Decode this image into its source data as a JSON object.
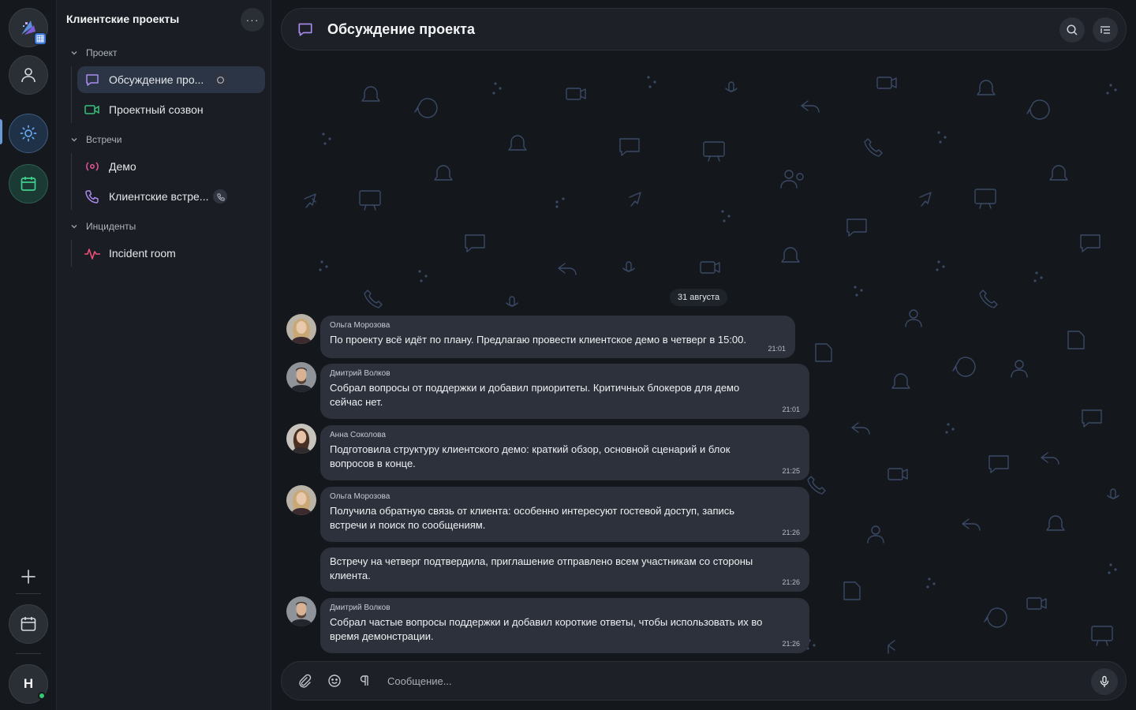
{
  "rail": {
    "user_initial": "Н"
  },
  "sidebar": {
    "title": "Клиентские проекты",
    "more_label": "···",
    "groups": [
      {
        "label": "Проект"
      },
      {
        "label": "Встречи"
      },
      {
        "label": "Инциденты"
      }
    ],
    "items": [
      {
        "label": "Обсуждение про...",
        "icon": "chat-icon"
      },
      {
        "label": "Проектный созвон",
        "icon": "video-icon"
      },
      {
        "label": "Демо",
        "icon": "broadcast-icon"
      },
      {
        "label": "Клиентские встре...",
        "icon": "phone-icon"
      },
      {
        "label": "Incident room",
        "icon": "pulse-icon"
      }
    ]
  },
  "header": {
    "title": "Обсуждение проекта"
  },
  "chat": {
    "date_divider": "31 августа",
    "messages": [
      {
        "author": "Ольга Морозова",
        "text": "По проекту всё идёт по плану. Предлагаю провести клиентское демо в четверг в 15:00.",
        "time": "21:01"
      },
      {
        "author": "Дмитрий Волков",
        "text": "Собрал вопросы от поддержки и добавил приоритеты. Критичных блокеров для демо сейчас нет.",
        "time": "21:01"
      },
      {
        "author": "Анна Соколова",
        "text": "Подготовила структуру клиентского демо: краткий обзор, основной сценарий и блок вопросов в конце.",
        "time": "21:25"
      },
      {
        "author": "Ольга Морозова",
        "text": "Получила обратную связь от клиента: особенно интересуют гостевой доступ, запись встречи и поиск по сообщениям.",
        "time": "21:26"
      },
      {
        "author": "",
        "text": "Встречу на четверг подтвердила, приглашение отправлено всем участникам со стороны клиента.",
        "time": "21:26"
      },
      {
        "author": "Дмитрий Волков",
        "text": "Собрал частые вопросы поддержки и добавил короткие ответы, чтобы использовать их во время демонстрации.",
        "time": "21:26"
      }
    ]
  },
  "composer": {
    "placeholder": "Сообщение..."
  },
  "colors": {
    "accent": "#6a9ad6",
    "online": "#37c871",
    "bubble": "#2c313b"
  }
}
